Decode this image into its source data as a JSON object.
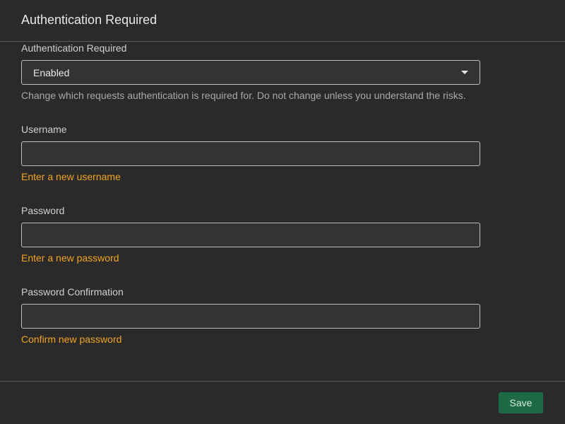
{
  "header": {
    "title": "Authentication Required"
  },
  "fields": {
    "auth_required": {
      "label": "Authentication Required",
      "value": "Enabled",
      "help": "Change which requests authentication is required for. Do not change unless you understand the risks."
    },
    "username": {
      "label": "Username",
      "value": "",
      "hint": "Enter a new username"
    },
    "password": {
      "label": "Password",
      "value": "",
      "hint": "Enter a new password"
    },
    "password_confirmation": {
      "label": "Password Confirmation",
      "value": "",
      "hint": "Confirm new password"
    }
  },
  "footer": {
    "save_label": "Save"
  },
  "colors": {
    "background": "#2a2a2a",
    "warning": "#f2a516",
    "save_button": "#1e6a46"
  }
}
